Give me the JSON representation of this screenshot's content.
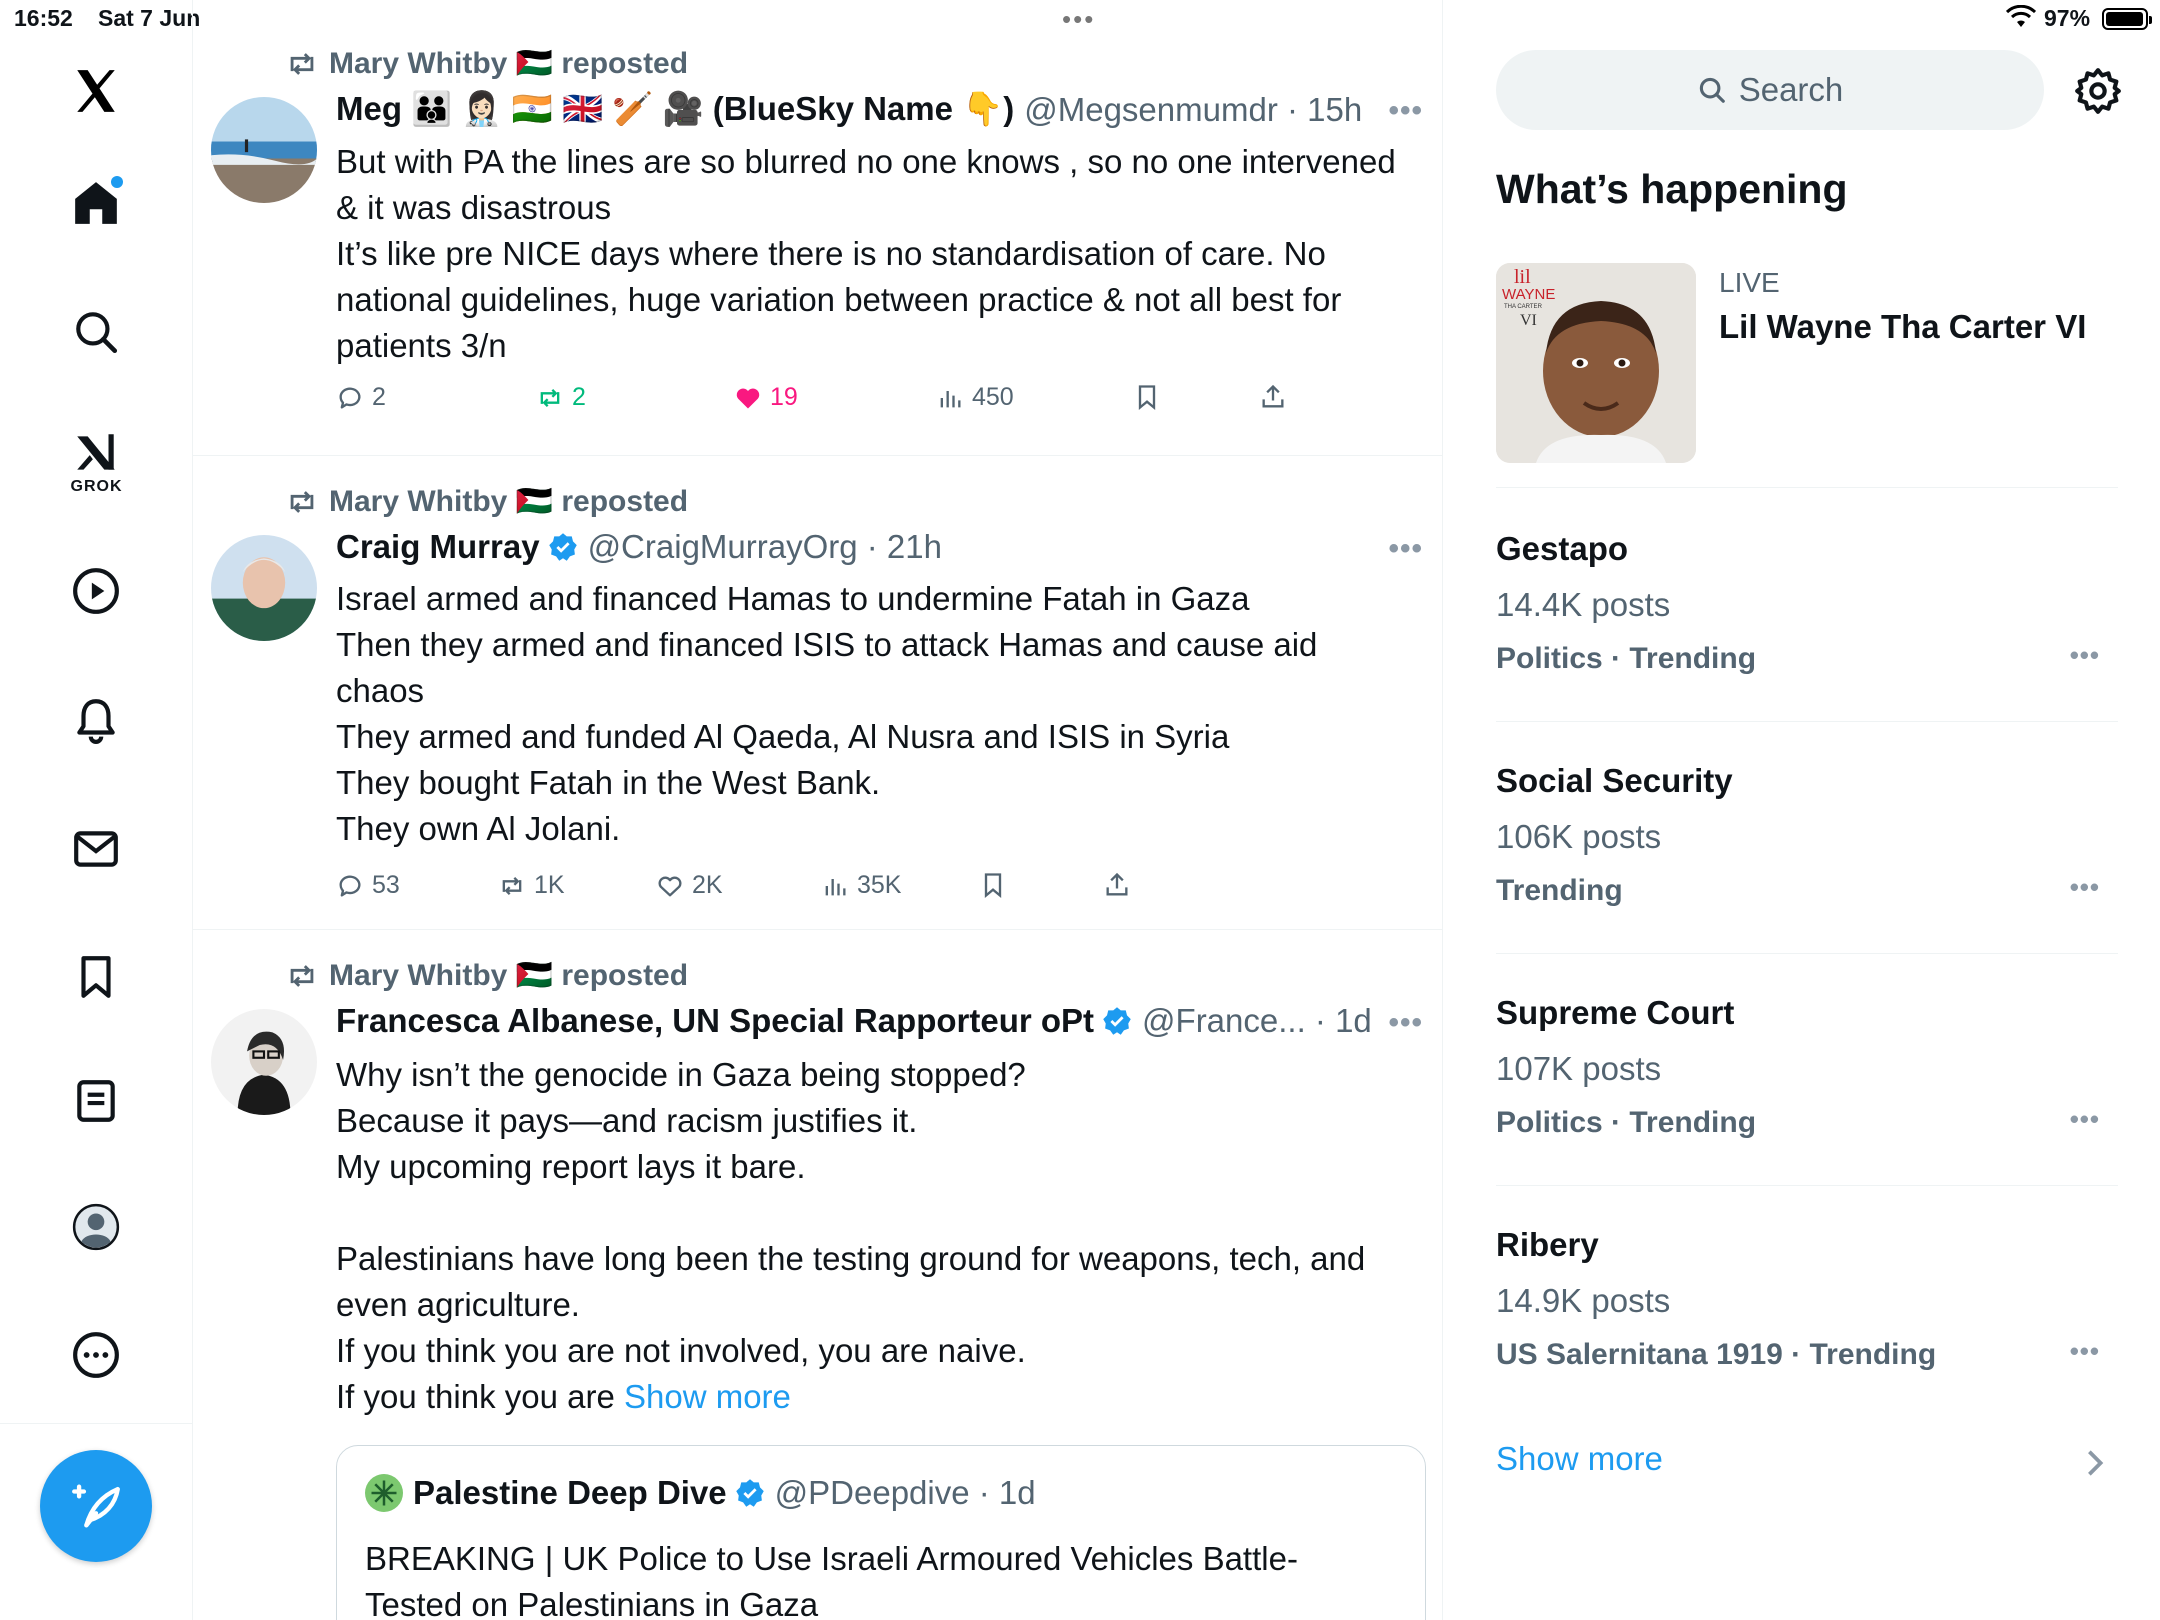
{
  "status_bar": {
    "time": "16:52",
    "date": "Sat 7 Jun",
    "battery": "97%",
    "battery_level": 0.97
  },
  "nav": {
    "grok_label": "GROK"
  },
  "posts": [
    {
      "repost_by": "Mary Whitby 🇵🇸 reposted",
      "author": "Meg 🧑‍🧑‍🧒 👩🏻‍⚕️ 🇮🇳 🇬🇧 🏏 🎥 (BlueSky Name 👇)",
      "handle": "@Megsenmumdr · 15h",
      "text": "But with PA the lines are so blurred no one knows , so no one intervened & it was disastrous\nIt’s like pre NICE days where there is no standardisation of care. No national guidelines, huge variation between practice & not all best for patients 3/n",
      "replies": "2",
      "reposts": "2",
      "likes": "19",
      "views": "450"
    },
    {
      "repost_by": "Mary Whitby 🇵🇸 reposted",
      "author": "Craig Murray",
      "handle": "@CraigMurrayOrg · 21h",
      "text": "Israel armed and financed Hamas to undermine Fatah in Gaza\nThen they armed and financed ISIS to attack Hamas and cause aid chaos\nThey armed and funded Al Qaeda, Al Nusra and ISIS in Syria\nThey bought Fatah in the West Bank.\nThey own Al Jolani.",
      "replies": "53",
      "reposts": "1K",
      "likes": "2K",
      "views": "35K"
    },
    {
      "repost_by": "Mary Whitby 🇵🇸 reposted",
      "author": "Francesca Albanese, UN Special Rapporteur oPt",
      "handle": "@France... · 1d",
      "text": "Why isn’t the genocide in Gaza being stopped?\nBecause it pays—and racism justifies it.\nMy upcoming report lays it bare.\n\nPalestinians have long been the testing ground for weapons, tech, and even agriculture.\nIf you think you are not involved, you are naive.\nIf you think you are ",
      "show_more": "Show more",
      "quote": {
        "author": "Palestine Deep Dive",
        "handle": "@PDeepdive · 1d",
        "text": "BREAKING | UK Police to Use Israeli Armoured Vehicles Battle-Tested on Palestinians in Gaza"
      }
    }
  ],
  "sidebar": {
    "search_placeholder": "Search",
    "section_title": "What’s happening",
    "live": {
      "label": "LIVE",
      "title": "Lil Wayne Tha Carter VI",
      "cover_text_1": "lil",
      "cover_text_2": "WAYNE",
      "cover_text_3": "THA CARTER",
      "cover_text_4": "VI"
    },
    "trends": [
      {
        "name": "Gestapo",
        "count": "14.4K posts",
        "category": "Politics · Trending"
      },
      {
        "name": "Social Security",
        "count": "106K posts",
        "category": "Trending"
      },
      {
        "name": "Supreme Court",
        "count": "107K posts",
        "category": "Politics · Trending"
      },
      {
        "name": "Ribery",
        "count": "14.9K posts",
        "category": "US Salernitana 1919 · Trending"
      }
    ],
    "show_more": "Show more"
  },
  "colors": {
    "accent": "#1d9bf0",
    "muted": "#536471",
    "repost_green": "#00ba7c",
    "like_pink": "#f91880"
  }
}
